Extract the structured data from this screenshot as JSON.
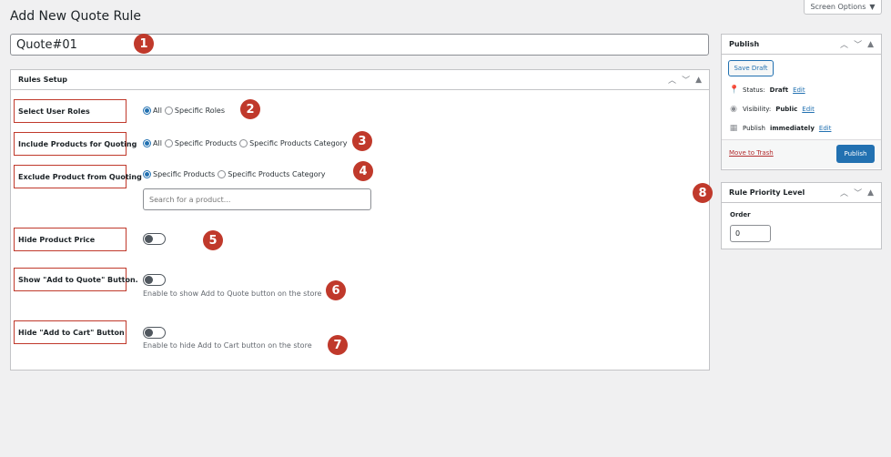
{
  "screen_options": {
    "label": "Screen Options",
    "arrow": "▼"
  },
  "page_title": "Add New Quote Rule",
  "title_input": {
    "value": "Quote#01"
  },
  "rules_setup": {
    "title": "Rules Setup",
    "select_user_roles": {
      "label": "Select User Roles",
      "options": [
        "All",
        "Specific Roles"
      ],
      "selected": "All"
    },
    "include_products": {
      "label": "Include Products for Quoting",
      "options": [
        "All",
        "Specific Products",
        "Specific Products Category"
      ],
      "selected": "All"
    },
    "exclude_product": {
      "label": "Exclude Product from Quoting",
      "options": [
        "Specific Products",
        "Specific Products Category"
      ],
      "selected": "Specific Products",
      "search_placeholder": "Search for a product..."
    },
    "hide_product_price": {
      "label": "Hide Product Price",
      "enabled": false
    },
    "show_add_to_quote": {
      "label": "Show \"Add to Quote\" Button.",
      "enabled": false,
      "help": "Enable to show Add to Quote button on the store"
    },
    "hide_add_to_cart": {
      "label": "Hide \"Add to Cart\" Button",
      "enabled": false,
      "help": "Enable to hide Add to Cart button on the store"
    }
  },
  "publish": {
    "title": "Publish",
    "save_draft": "Save Draft",
    "status_label": "Status:",
    "status_value": "Draft",
    "visibility_label": "Visibility:",
    "visibility_value": "Public",
    "publish_label": "Publish",
    "publish_value": "immediately",
    "edit": "Edit",
    "move_to_trash": "Move to Trash",
    "publish_button": "Publish"
  },
  "priority": {
    "title": "Rule Priority Level",
    "order_label": "Order",
    "order_value": "0"
  },
  "badges": [
    "1",
    "2",
    "3",
    "4",
    "5",
    "6",
    "7",
    "8"
  ],
  "colors": {
    "accent": "#2271b1",
    "highlight": "#c0392b",
    "background": "#f0f0f1"
  }
}
